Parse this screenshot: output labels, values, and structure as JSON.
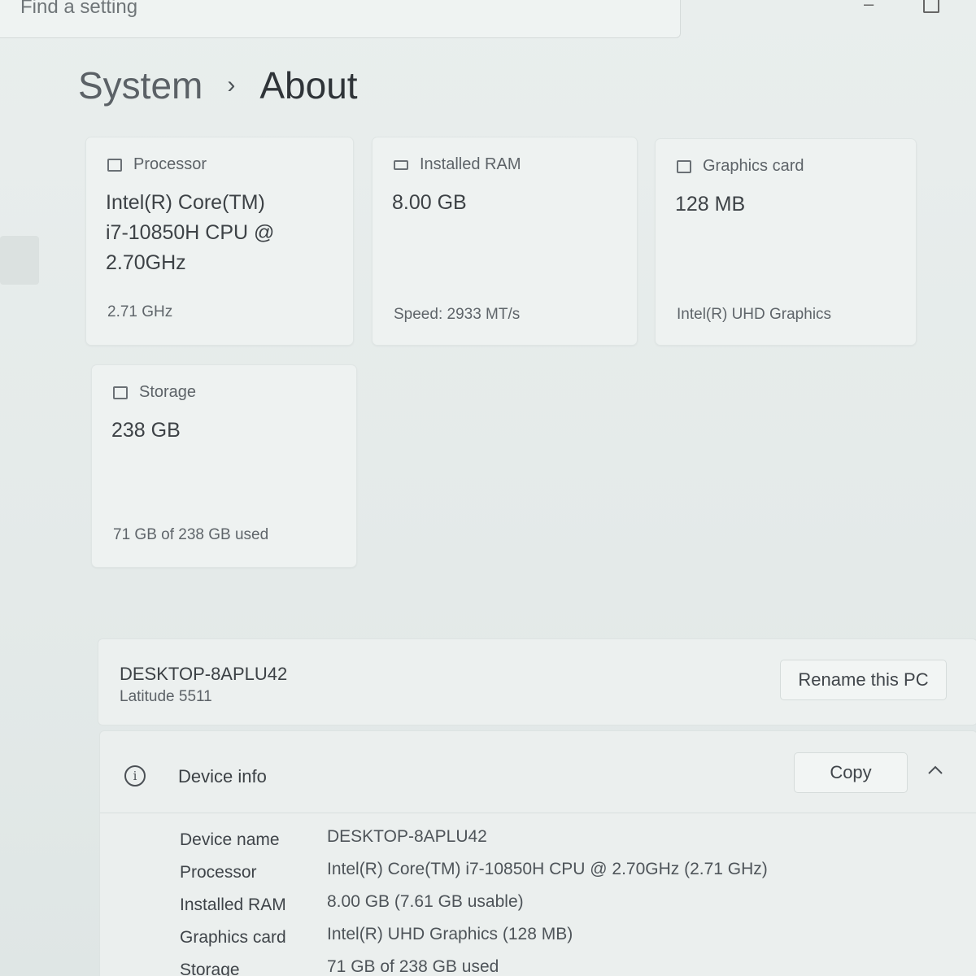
{
  "search": {
    "placeholder": "Find a setting"
  },
  "breadcrumb": {
    "parent": "System",
    "separator": "›",
    "current": "About"
  },
  "cards": {
    "processor": {
      "title": "Processor",
      "value": "Intel(R) Core(TM)\ni7-10850H CPU @\n2.70GHz",
      "sub": "2.71 GHz"
    },
    "ram": {
      "title": "Installed RAM",
      "value": "8.00 GB",
      "sub": "Speed: 2933 MT/s"
    },
    "graphics": {
      "title": "Graphics card",
      "value": "128 MB",
      "sub": "Intel(R) UHD Graphics"
    },
    "storage": {
      "title": "Storage",
      "value": "238 GB",
      "sub": "71 GB of 238 GB used"
    }
  },
  "device": {
    "name": "DESKTOP-8APLU42",
    "model": "Latitude 5511",
    "rename_label": "Rename this PC"
  },
  "device_info": {
    "title": "Device info",
    "copy_label": "Copy",
    "rows": [
      {
        "label": "Device name",
        "value": "DESKTOP-8APLU42"
      },
      {
        "label": "Processor",
        "value": "Intel(R) Core(TM) i7-10850H CPU @ 2.70GHz (2.71 GHz)"
      },
      {
        "label": "Installed RAM",
        "value": "8.00 GB (7.61 GB usable)"
      },
      {
        "label": "Graphics card",
        "value": "Intel(R) UHD Graphics (128 MB)"
      },
      {
        "label": "Storage",
        "value": "71 GB of 238 GB used"
      }
    ]
  }
}
